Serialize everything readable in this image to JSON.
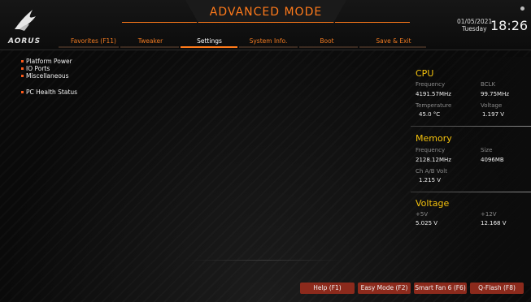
{
  "header": {
    "brand": "AORUS",
    "title": "ADVANCED MODE",
    "date": "01/05/2021",
    "day": "Tuesday",
    "time": "18:26",
    "accent_color": "#ff7a1a"
  },
  "tabs": [
    {
      "label": "Favorites (F11)",
      "active": false
    },
    {
      "label": "Tweaker",
      "active": false
    },
    {
      "label": "Settings",
      "active": true
    },
    {
      "label": "System Info.",
      "active": false
    },
    {
      "label": "Boot",
      "active": false
    },
    {
      "label": "Save & Exit",
      "active": false
    }
  ],
  "menu": {
    "items": [
      {
        "label": "Platform Power"
      },
      {
        "label": "IO Ports"
      },
      {
        "label": "Miscellaneous"
      },
      {
        "label": "PC Health Status"
      }
    ]
  },
  "status": {
    "cpu": {
      "title": "CPU",
      "frequency_label": "Frequency",
      "frequency": "4191.57MHz",
      "bclk_label": "BCLK",
      "bclk": "99.75MHz",
      "temperature_label": "Temperature",
      "temperature": "45.0 °C",
      "voltage_label": "Voltage",
      "voltage": "1.197 V"
    },
    "memory": {
      "title": "Memory",
      "frequency_label": "Frequency",
      "frequency": "2128.12MHz",
      "size_label": "Size",
      "size": "4096MB",
      "volt_label": "Ch A/B Volt",
      "volt": "1.215 V"
    },
    "voltage": {
      "title": "Voltage",
      "v5_label": "+5V",
      "v5": "5.025 V",
      "v12_label": "+12V",
      "v12": "12.168 V"
    },
    "title_color": "#f4c20d"
  },
  "footer": {
    "buttons": [
      {
        "label": "Help (F1)"
      },
      {
        "label": "Easy Mode (F2)"
      },
      {
        "label": "Smart Fan 6 (F6)"
      },
      {
        "label": "Q-Flash (F8)"
      }
    ]
  }
}
